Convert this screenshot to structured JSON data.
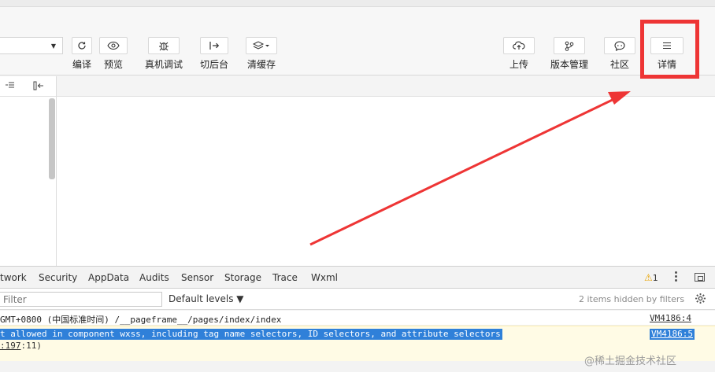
{
  "toolbar": {
    "buttons": [
      {
        "id": "compile",
        "label": "编译",
        "icon": "refresh-icon"
      },
      {
        "id": "preview",
        "label": "预览",
        "icon": "eye-icon"
      },
      {
        "id": "remote-debug",
        "label": "真机调试",
        "icon": "bug-icon"
      },
      {
        "id": "switch-bg",
        "label": "切后台",
        "icon": "switch-icon"
      },
      {
        "id": "clear-cache",
        "label": "清缓存",
        "icon": "layers-icon"
      },
      {
        "id": "upload",
        "label": "上传",
        "icon": "cloud-upload-icon"
      },
      {
        "id": "version",
        "label": "版本管理",
        "icon": "branch-icon"
      },
      {
        "id": "community",
        "label": "社区",
        "icon": "chat-icon"
      },
      {
        "id": "details",
        "label": "详情",
        "icon": "menu-icon"
      }
    ]
  },
  "devtools": {
    "tabs": [
      "twork",
      "Security",
      "AppData",
      "Audits",
      "Sensor",
      "Storage",
      "Trace",
      "Wxml"
    ],
    "warning_count": "1",
    "filter_placeholder": "Filter",
    "levels_label": "Default levels ▼",
    "hidden_note": "2 items hidden by filters"
  },
  "console": {
    "log_text": "GMT+0800 (中国标准时间) /__pageframe__/pages/index/index",
    "log_source": "VM4186:4",
    "warn_text": "t allowed in component wxss, including tag name selectors, ID selectors, and attribute selectors",
    "warn_source": "VM4186:5",
    "warn_line2_link": ":197",
    "warn_line2_tail": ":11)"
  },
  "watermark": "@稀土掘金技术社区",
  "colors": {
    "highlight": "#ee3535",
    "selection": "#2f80d9",
    "warn_bg": "#fffbe5"
  }
}
